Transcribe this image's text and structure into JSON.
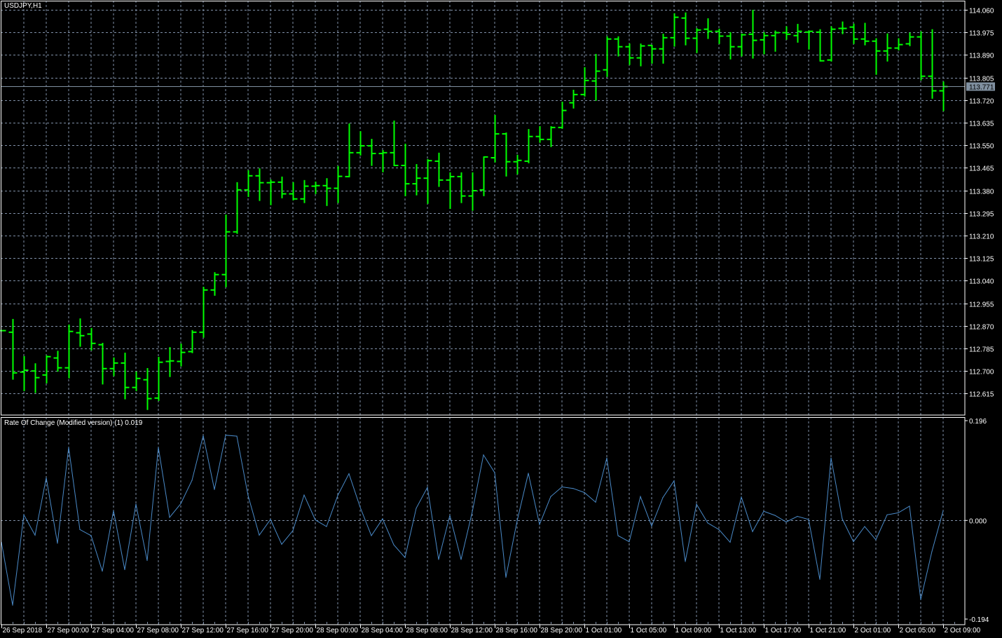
{
  "header": {
    "symbol_title": "USDJPY,H1"
  },
  "indicator": {
    "label": "Rate Of Change (Modified version) (1) 0.019"
  },
  "colors": {
    "background": "#000000",
    "bars": "#00FF00",
    "grid": "#8090A8",
    "indicator_line": "#4A8AC8",
    "axis": "#FFFFFF",
    "price_line": "#8090A0",
    "price_badge": "#8090A0"
  },
  "chart_data": [
    {
      "type": "ohlc",
      "title": "USDJPY,H1",
      "ylim": [
        112.615,
        114.06
      ],
      "y_ticks": [
        "114.060",
        "113.975",
        "113.890",
        "113.805",
        "113.720",
        "113.635",
        "113.550",
        "113.465",
        "113.380",
        "113.295",
        "113.210",
        "113.125",
        "113.040",
        "112.955",
        "112.870",
        "112.785",
        "112.700",
        "112.615"
      ],
      "current_price": "113.771",
      "x_tick_labels": [
        "26 Sep 2018",
        "27 Sep 00:00",
        "27 Sep 04:00",
        "27 Sep 08:00",
        "27 Sep 12:00",
        "27 Sep 16:00",
        "27 Sep 20:00",
        "28 Sep 00:00",
        "28 Sep 04:00",
        "28 Sep 08:00",
        "28 Sep 12:00",
        "28 Sep 16:00",
        "28 Sep 20:00",
        "1 Oct 01:00",
        "1 Oct 05:00",
        "1 Oct 09:00",
        "1 Oct 13:00",
        "1 Oct 17:00",
        "1 Oct 21:00",
        "2 Oct 01:00",
        "2 Oct 05:00",
        "2 Oct 09:00"
      ],
      "grid": true,
      "ohlc": [
        [
          112.852,
          112.852,
          112.852,
          112.852
        ],
        [
          112.846,
          112.896,
          112.67,
          112.693
        ],
        [
          112.696,
          112.756,
          112.627,
          112.703
        ],
        [
          112.7,
          112.729,
          112.62,
          112.675
        ],
        [
          112.685,
          112.759,
          112.656,
          112.754
        ],
        [
          112.749,
          112.776,
          112.7,
          112.712
        ],
        [
          112.712,
          112.875,
          112.675,
          112.849
        ],
        [
          112.844,
          112.898,
          112.794,
          112.833
        ],
        [
          112.839,
          112.862,
          112.78,
          112.804
        ],
        [
          112.799,
          112.806,
          112.652,
          112.709
        ],
        [
          112.709,
          112.751,
          112.683,
          112.73
        ],
        [
          112.73,
          112.769,
          112.596,
          112.638
        ],
        [
          112.638,
          112.698,
          112.627,
          112.672
        ],
        [
          112.667,
          112.711,
          112.556,
          112.596
        ],
        [
          112.598,
          112.753,
          112.59,
          112.733
        ],
        [
          112.736,
          112.79,
          112.68,
          112.738
        ],
        [
          112.736,
          112.803,
          112.72,
          112.77
        ],
        [
          112.773,
          112.854,
          112.77,
          112.846
        ],
        [
          112.846,
          113.017,
          112.828,
          113.005
        ],
        [
          113.005,
          113.072,
          112.986,
          113.063
        ],
        [
          113.063,
          113.289,
          113.018,
          113.224
        ],
        [
          113.224,
          113.411,
          113.219,
          113.382
        ],
        [
          113.382,
          113.456,
          113.358,
          113.435
        ],
        [
          113.435,
          113.463,
          113.343,
          113.409
        ],
        [
          113.409,
          113.421,
          113.327,
          113.411
        ],
        [
          113.411,
          113.432,
          113.353,
          113.367
        ],
        [
          113.367,
          113.411,
          113.345,
          113.348
        ],
        [
          113.348,
          113.419,
          113.335,
          113.396
        ],
        [
          113.396,
          113.413,
          113.369,
          113.398
        ],
        [
          113.398,
          113.426,
          113.324,
          113.388
        ],
        [
          113.388,
          113.472,
          113.335,
          113.433
        ],
        [
          113.432,
          113.632,
          113.432,
          113.522
        ],
        [
          113.522,
          113.603,
          113.514,
          113.548
        ],
        [
          113.548,
          113.574,
          113.475,
          113.519
        ],
        [
          113.519,
          113.532,
          113.451,
          113.522
        ],
        [
          113.522,
          113.643,
          113.474,
          113.474
        ],
        [
          113.474,
          113.556,
          113.361,
          113.405
        ],
        [
          113.405,
          113.479,
          113.364,
          113.426
        ],
        [
          113.426,
          113.498,
          113.332,
          113.492
        ],
        [
          113.49,
          113.522,
          113.396,
          113.419
        ],
        [
          113.419,
          113.448,
          113.313,
          113.432
        ],
        [
          113.432,
          113.448,
          113.335,
          113.359
        ],
        [
          113.359,
          113.448,
          113.306,
          113.379
        ],
        [
          113.382,
          113.508,
          113.361,
          113.506
        ],
        [
          113.503,
          113.664,
          113.488,
          113.593
        ],
        [
          113.593,
          113.598,
          113.435,
          113.488
        ],
        [
          113.488,
          113.514,
          113.443,
          113.493
        ],
        [
          113.49,
          113.611,
          113.485,
          113.583
        ],
        [
          113.583,
          113.622,
          113.562,
          113.572
        ],
        [
          113.572,
          113.622,
          113.546,
          113.617
        ],
        [
          113.617,
          113.714,
          113.615,
          113.681
        ],
        [
          113.71,
          113.759,
          113.691,
          113.741
        ],
        [
          113.741,
          113.844,
          113.736,
          113.794
        ],
        [
          113.792,
          113.894,
          113.72,
          113.829
        ],
        [
          113.834,
          113.96,
          113.81,
          113.95
        ],
        [
          113.95,
          113.96,
          113.887,
          113.921
        ],
        [
          113.921,
          113.933,
          113.855,
          113.879
        ],
        [
          113.879,
          113.933,
          113.85,
          113.924
        ],
        [
          113.926,
          113.928,
          113.86,
          113.913
        ],
        [
          113.913,
          113.97,
          113.86,
          113.955
        ],
        [
          113.955,
          114.047,
          113.924,
          114.032
        ],
        [
          114.029,
          114.05,
          113.929,
          113.953
        ],
        [
          113.953,
          113.991,
          113.9,
          113.984
        ],
        [
          113.987,
          114.028,
          113.953,
          113.979
        ],
        [
          113.979,
          113.989,
          113.934,
          113.961
        ],
        [
          113.961,
          113.976,
          113.876,
          113.921
        ],
        [
          113.921,
          113.971,
          113.887,
          113.966
        ],
        [
          113.968,
          114.06,
          113.879,
          113.945
        ],
        [
          113.947,
          113.976,
          113.895,
          113.963
        ],
        [
          113.963,
          113.982,
          113.905,
          113.974
        ],
        [
          113.974,
          113.998,
          113.95,
          113.968
        ],
        [
          113.963,
          114.007,
          113.939,
          113.979
        ],
        [
          113.976,
          113.982,
          113.913,
          113.979
        ],
        [
          113.976,
          113.987,
          113.868,
          113.868
        ],
        [
          113.871,
          113.998,
          113.868,
          113.987
        ],
        [
          113.99,
          114.016,
          113.971,
          113.99
        ],
        [
          113.995,
          114.008,
          113.934,
          113.95
        ],
        [
          113.95,
          114.011,
          113.929,
          113.942
        ],
        [
          113.942,
          113.953,
          113.818,
          113.905
        ],
        [
          113.905,
          113.971,
          113.868,
          113.916
        ],
        [
          113.916,
          113.953,
          113.91,
          113.929
        ],
        [
          113.932,
          113.974,
          113.926,
          113.958
        ],
        [
          113.958,
          113.979,
          113.797,
          113.81
        ],
        [
          113.81,
          113.987,
          113.728,
          113.755
        ],
        [
          113.755,
          113.79,
          113.681,
          113.771
        ]
      ]
    },
    {
      "type": "line",
      "title": "Rate Of Change (Modified version) (1) 0.019",
      "ylim": [
        -0.194,
        0.196
      ],
      "y_ticks": [
        "0.196",
        "0.000",
        "-0.194"
      ],
      "values": [
        -0.043,
        -0.167,
        0.011,
        -0.029,
        0.084,
        -0.045,
        0.144,
        -0.018,
        -0.03,
        -0.1,
        0.019,
        -0.097,
        0.032,
        -0.079,
        0.144,
        0.006,
        0.033,
        0.079,
        0.167,
        0.061,
        0.168,
        0.166,
        0.049,
        -0.029,
        0.002,
        -0.047,
        -0.02,
        0.05,
        0.001,
        -0.012,
        0.049,
        0.092,
        0.026,
        -0.03,
        0.003,
        -0.048,
        -0.073,
        0.024,
        0.065,
        -0.077,
        0.01,
        -0.077,
        0.017,
        0.129,
        0.094,
        -0.112,
        -0.001,
        0.093,
        -0.008,
        0.047,
        0.066,
        0.063,
        0.055,
        0.036,
        0.123,
        -0.03,
        -0.042,
        0.047,
        -0.011,
        0.045,
        0.078,
        -0.081,
        0.032,
        -0.005,
        -0.018,
        -0.043,
        0.046,
        -0.022,
        0.018,
        0.01,
        -0.003,
        0.008,
        0.002,
        -0.116,
        0.123,
        0.003,
        -0.042,
        -0.012,
        -0.038,
        0.011,
        0.015,
        0.028,
        -0.156,
        -0.061,
        0.019
      ]
    }
  ]
}
